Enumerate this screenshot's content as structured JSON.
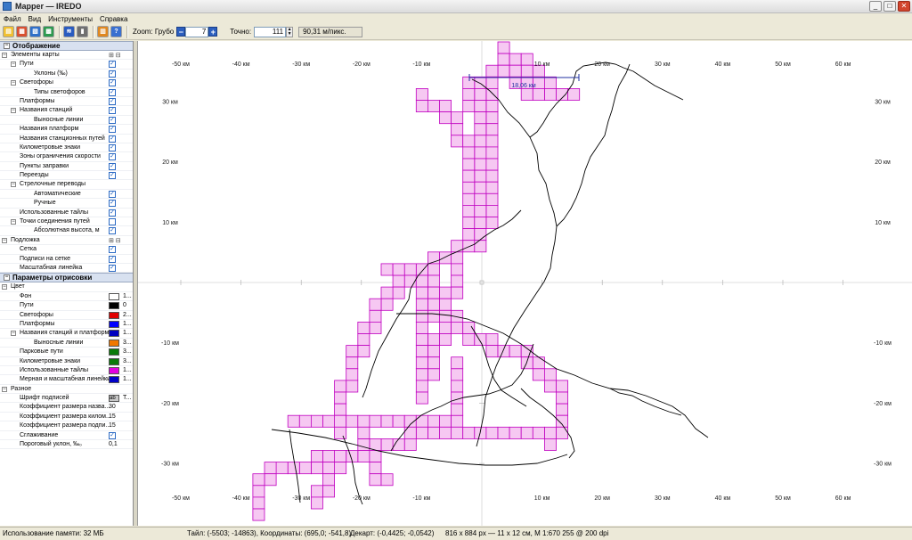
{
  "window": {
    "title": "Mapper — IREDO",
    "buttons": [
      "_",
      "□",
      "✕"
    ]
  },
  "menu": [
    {
      "label": "Файл"
    },
    {
      "label": "Вид"
    },
    {
      "label": "Инструменты"
    },
    {
      "label": "Справка"
    }
  ],
  "toolbar": {
    "zoom_label": "Zoom: Грубо",
    "zoom_value": "7",
    "precise_label": "Точно:",
    "precise_value": "111",
    "scale_text": "90,31 м/пикс."
  },
  "panel": {
    "display_header": "Отображение",
    "params_header": "Параметры отрисовки",
    "display_rows": [
      {
        "label": "Элементы карты",
        "level": 0,
        "expander": "−",
        "control": "plusminus"
      },
      {
        "label": "Пути",
        "level": 1,
        "expander": "−",
        "control": "check"
      },
      {
        "label": "Уклоны (‰)",
        "level": 2,
        "control": "check"
      },
      {
        "label": "Светофоры",
        "level": 1,
        "expander": "−",
        "control": "check"
      },
      {
        "label": "Типы светофоров",
        "level": 2,
        "control": "check"
      },
      {
        "label": "Платформы",
        "level": 1,
        "control": "check"
      },
      {
        "label": "Названия станций",
        "level": 1,
        "expander": "−",
        "control": "check"
      },
      {
        "label": "Выносные линии",
        "level": 2,
        "control": "check"
      },
      {
        "label": "Названия платформ",
        "level": 1,
        "control": "check"
      },
      {
        "label": "Названия станционных путей",
        "level": 1,
        "control": "check"
      },
      {
        "label": "Километровые знаки",
        "level": 1,
        "control": "check"
      },
      {
        "label": "Зоны ограничения скорости",
        "level": 1,
        "control": "check"
      },
      {
        "label": "Пункты заправки",
        "level": 1,
        "control": "check"
      },
      {
        "label": "Переезды",
        "level": 1,
        "control": "check"
      },
      {
        "label": "Стрелочные переводы",
        "level": 1,
        "expander": "−",
        "control": "none"
      },
      {
        "label": "Автоматические",
        "level": 2,
        "control": "check"
      },
      {
        "label": "Ручные",
        "level": 2,
        "control": "check"
      },
      {
        "label": "Использованные тайлы",
        "level": 1,
        "control": "check"
      },
      {
        "label": "Точки соединения путей",
        "level": 1,
        "expander": "−",
        "control": "empty"
      },
      {
        "label": "Абсолютная высота, м",
        "level": 2,
        "control": "check"
      },
      {
        "label": "Подложка",
        "level": 0,
        "expander": "−",
        "control": "plusminus"
      },
      {
        "label": "Сетка",
        "level": 1,
        "control": "check"
      },
      {
        "label": "Подписи на сетке",
        "level": 1,
        "control": "check"
      },
      {
        "label": "Масштабная линейка",
        "level": 1,
        "control": "check"
      }
    ],
    "param_rows": [
      {
        "label": "Цвет",
        "level": 0,
        "expander": "−",
        "control": "none"
      },
      {
        "label": "Фон",
        "level": 1,
        "control": "color",
        "color": "#ffffff",
        "value": "1..."
      },
      {
        "label": "Пути",
        "level": 1,
        "control": "color",
        "color": "#000000",
        "value": "0"
      },
      {
        "label": "Светофоры",
        "level": 1,
        "control": "color",
        "color": "#e00000",
        "value": "2..."
      },
      {
        "label": "Платформы",
        "level": 1,
        "control": "color",
        "color": "#0000ff",
        "value": "1..."
      },
      {
        "label": "Названия станций и платформ",
        "level": 1,
        "expander": "−",
        "control": "color",
        "color": "#0000c0",
        "value": "1..."
      },
      {
        "label": "Выносные линии",
        "level": 2,
        "control": "color",
        "color": "#f07800",
        "value": "3..."
      },
      {
        "label": "Парковые пути",
        "level": 1,
        "control": "color",
        "color": "#0a7a0a",
        "value": "3..."
      },
      {
        "label": "Километровые знаки",
        "level": 1,
        "control": "color",
        "color": "#0a7a0a",
        "value": "3..."
      },
      {
        "label": "Использованные тайлы",
        "level": 1,
        "control": "color",
        "color": "#e000e0",
        "value": "1..."
      },
      {
        "label": "Мерная и масштабная линейки",
        "level": 1,
        "control": "color",
        "color": "#0000c8",
        "value": "1..."
      },
      {
        "label": "Разное",
        "level": 0,
        "expander": "−",
        "control": "none"
      },
      {
        "label": "Шрифт подписей",
        "level": 1,
        "control": "font",
        "value": "T..."
      },
      {
        "label": "Коэффициент размера назва...",
        "level": 1,
        "control": "text",
        "value": "30"
      },
      {
        "label": "Коэффициент размера килом...",
        "level": 1,
        "control": "text",
        "value": "15"
      },
      {
        "label": "Коэффициент размера подпи...",
        "level": 1,
        "control": "text",
        "value": "15"
      },
      {
        "label": "Сглаживание",
        "level": 1,
        "control": "check"
      },
      {
        "label": "Пороговый уклон, ‰₀",
        "level": 1,
        "control": "text",
        "value": "0,1"
      }
    ]
  },
  "map": {
    "x_labels": [
      "-50 км",
      "-40 км",
      "-30 км",
      "-20 км",
      "-10 км",
      "10 км",
      "20 км",
      "30 км",
      "40 км",
      "50 км",
      "60 км"
    ],
    "x_values": [
      -50,
      -40,
      -30,
      -20,
      -10,
      10,
      20,
      30,
      40,
      50,
      60
    ],
    "y_labels": [
      "30 км",
      "20 км",
      "10 км",
      "-10 км",
      "-20 км",
      "-30 км"
    ],
    "y_values": [
      30,
      20,
      10,
      -10,
      -20,
      -30
    ],
    "ruler_label": "18,06 км",
    "colors": {
      "tile_fill": "#f6c8f2",
      "tile_stroke": "#c000c0",
      "grid": "#d4d4d4",
      "track": "#000000",
      "ruler": "#2030a0"
    }
  },
  "status": {
    "memory": "Использование памяти: 32 МБ",
    "tile": "Тайл: (-5503; -14863), Координаты: (695,0; -541,8)",
    "cartesian": "Декарт: (-0,4425; -0,0542)",
    "size": "816 x 884 px — 11 x 12 см, М 1:670 255 @ 200 dpi"
  }
}
